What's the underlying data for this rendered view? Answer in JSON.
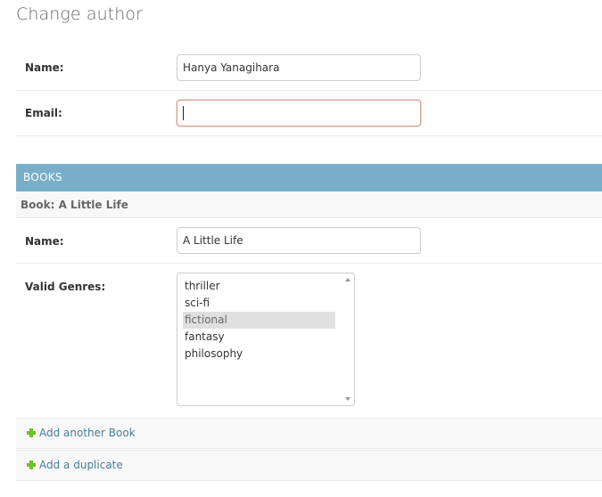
{
  "page": {
    "title": "Change author"
  },
  "author": {
    "name_label": "Name:",
    "name_value": "Hanya Yanagihara",
    "email_label": "Email:",
    "email_value": ""
  },
  "books": {
    "section_title": "BOOKS",
    "inline_title": "Book: A Little Life",
    "name_label": "Name:",
    "name_value": "A Little Life",
    "genres_label": "Valid Genres:",
    "genres": [
      {
        "label": "thriller",
        "selected": false
      },
      {
        "label": "sci-fi",
        "selected": false
      },
      {
        "label": "fictional",
        "selected": true
      },
      {
        "label": "fantasy",
        "selected": false
      },
      {
        "label": "philosophy",
        "selected": false
      }
    ],
    "add_another_label": "Add another Book",
    "add_duplicate_label": "Add a duplicate"
  },
  "colors": {
    "section_header_bg": "#79aec8",
    "link": "#447e9b",
    "add_icon": "#70bf2b",
    "focus_border": "#d4a393"
  },
  "icons": {
    "add": "plus-icon"
  }
}
